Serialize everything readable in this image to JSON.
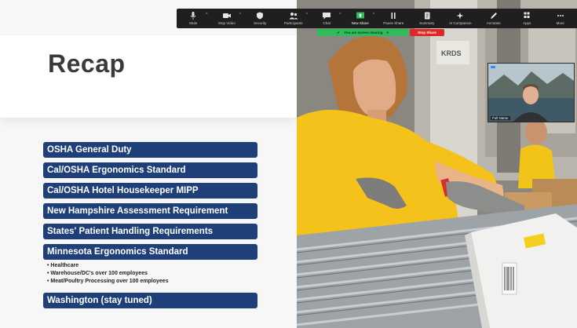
{
  "slide": {
    "title": "Recap",
    "items": [
      "OSHA General Duty",
      "Cal/OSHA Ergonomics Standard",
      "Cal/OSHA Hotel Housekeeper MIPP",
      "New Hampshire Assessment Requirement",
      "States' Patient Handling Requirements",
      "Minnesota Ergonomics Standard",
      "Washington (stay tuned)"
    ],
    "sub_items": [
      "Healthcare",
      "Warehouse/DC's over 100 employees",
      "Meat/Poultry Processing over 100 employees"
    ]
  },
  "toolbar": {
    "items": [
      {
        "label": "Mute",
        "icon": "microphone-icon"
      },
      {
        "label": "Stop Video",
        "icon": "video-camera-icon"
      },
      {
        "label": "Security",
        "icon": "shield-icon"
      },
      {
        "label": "Participants",
        "icon": "participants-icon"
      },
      {
        "label": "Chat",
        "icon": "chat-bubble-icon"
      },
      {
        "label": "New Share",
        "icon": "share-screen-icon"
      },
      {
        "label": "Pause Share",
        "icon": "pause-icon"
      },
      {
        "label": "Summary",
        "icon": "document-icon"
      },
      {
        "label": "AI Companion",
        "icon": "sparkle-icon"
      },
      {
        "label": "Annotate",
        "icon": "pen-icon"
      },
      {
        "label": "Apps",
        "icon": "apps-icon"
      },
      {
        "label": "More",
        "icon": "more-dots-icon"
      }
    ],
    "sharing_notice": "You are screen sharing",
    "stop_share_label": "Stop Share"
  },
  "photo": {
    "box_text": "KRDS"
  },
  "self_view": {
    "name": "Full Name"
  },
  "colors": {
    "recap_item_bg": "#1e3f78",
    "toolbar_bg": "#1f1f1f",
    "sharing_green": "#2ebd59",
    "stop_red": "#e02828"
  }
}
